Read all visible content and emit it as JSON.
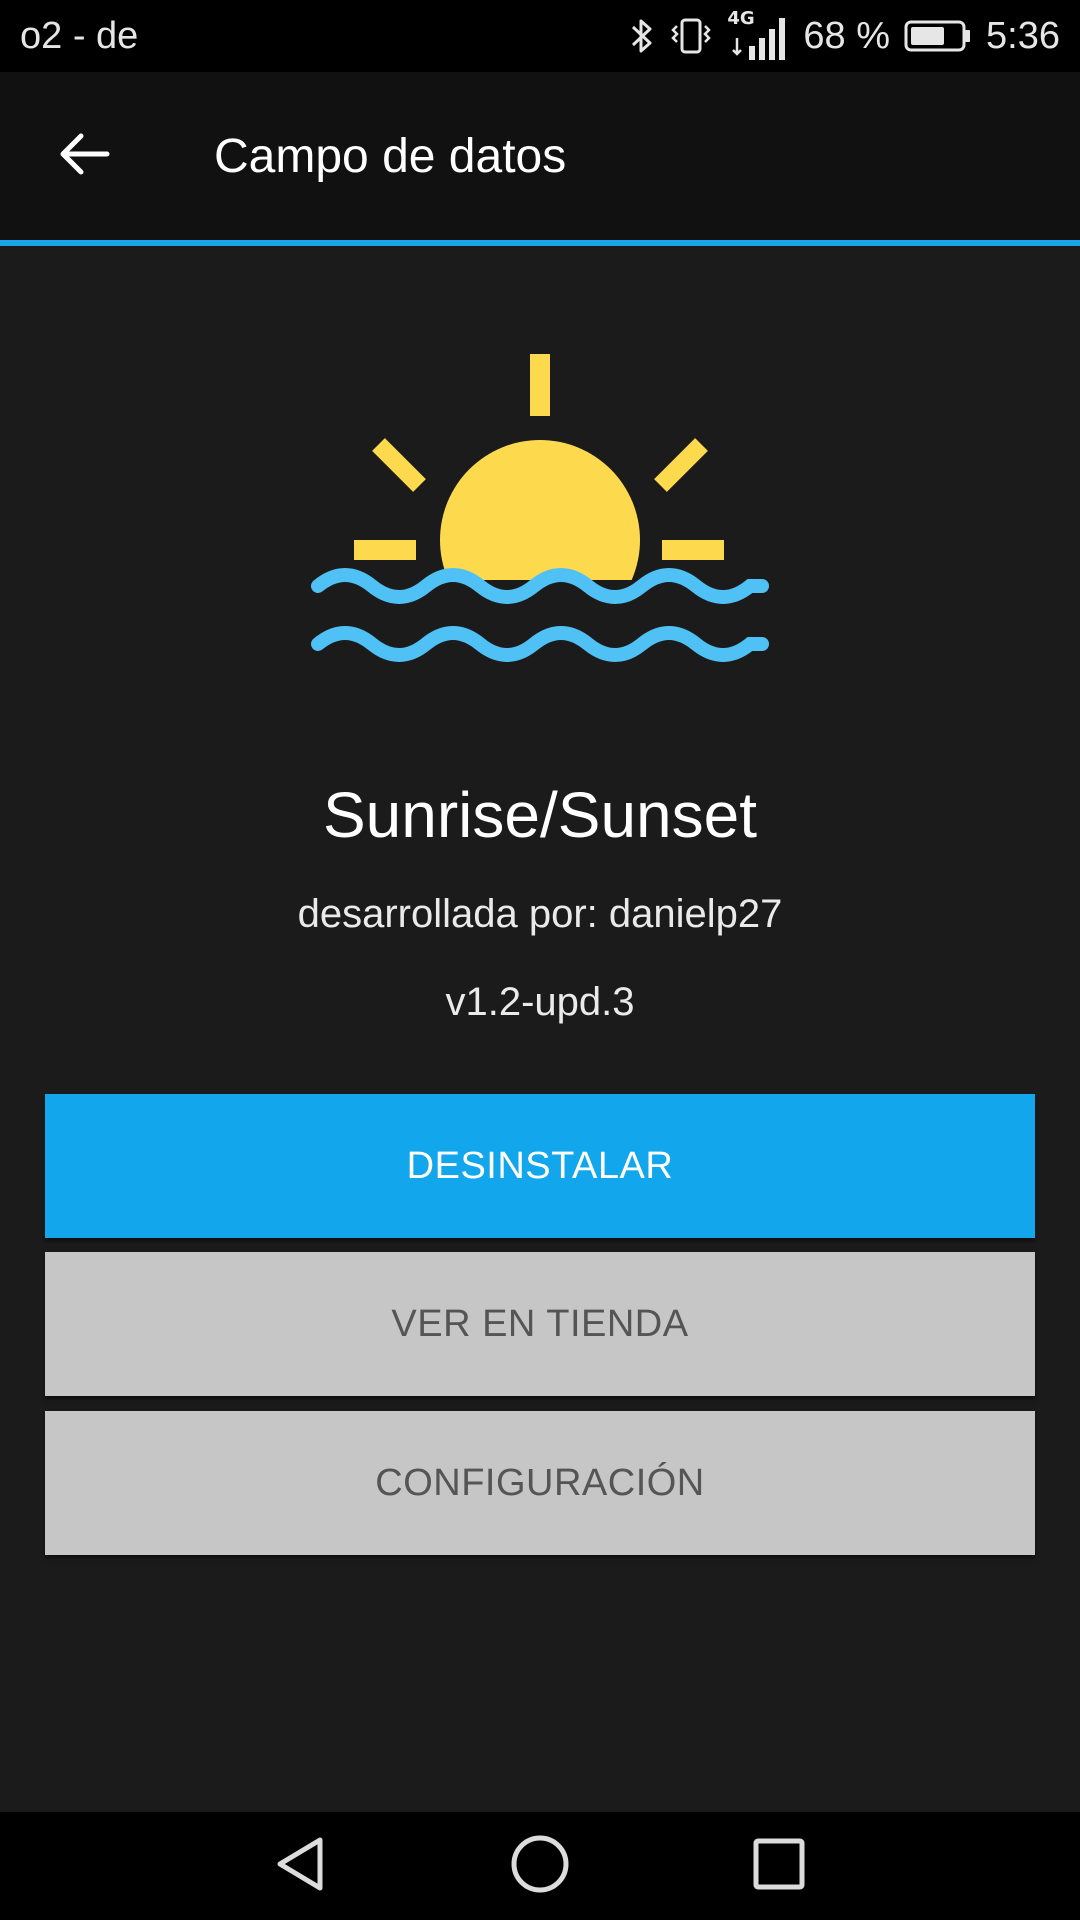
{
  "status_bar": {
    "carrier": "o2 - de",
    "network": "4G",
    "battery": "68 %",
    "battery_level": 0.68,
    "time": "5:36",
    "icons": [
      "bluetooth-icon",
      "vibrate-icon",
      "signal-icon",
      "battery-icon"
    ]
  },
  "app_bar": {
    "title": "Campo de datos",
    "back_icon": "arrow-left-icon"
  },
  "app": {
    "icon": "sunset-over-water-icon",
    "name": "Sunrise/Sunset",
    "developer": "desarrollada por: danielp27",
    "version": "v1.2-upd.3"
  },
  "buttons": {
    "uninstall": "DESINSTALAR",
    "store": "VER EN TIENDA",
    "settings": "CONFIGURACIÓN"
  },
  "nav_bar": {
    "icons": [
      "nav-back-icon",
      "nav-home-icon",
      "nav-recents-icon"
    ]
  },
  "colors": {
    "accent": "#12a7ec",
    "sun": "#fdd94e",
    "water": "#4fc1f5",
    "background": "#1b1b1b",
    "app_bar": "#111111"
  }
}
